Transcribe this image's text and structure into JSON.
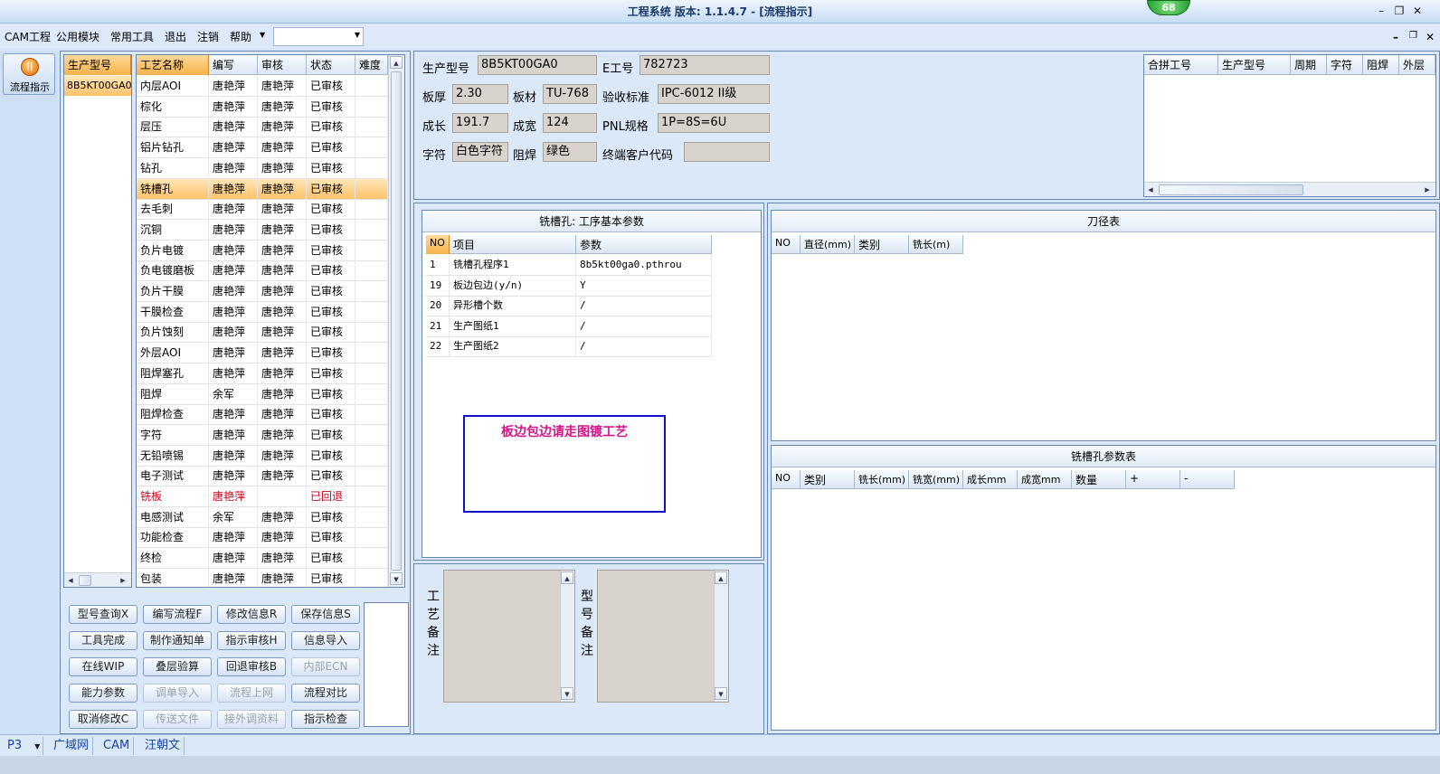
{
  "window": {
    "title": "工程系统    版本: 1.1.4.7 - [流程指示]",
    "badge": "68"
  },
  "menu": [
    "CAM工程",
    "公用模块",
    "常用工具",
    "退出",
    "注销",
    "帮助"
  ],
  "menu_combo_value": "",
  "sidebar": {
    "flow_button_label": "流程指示"
  },
  "model_list": {
    "header": "生产型号",
    "items": [
      "8B5KT00GA0"
    ]
  },
  "process_table": {
    "columns": [
      "工艺名称",
      "编写",
      "审核",
      "状态",
      "难度"
    ],
    "selected_index": 5,
    "rows": [
      [
        "内层AOI",
        "唐艳萍",
        "唐艳萍",
        "已审核",
        ""
      ],
      [
        "棕化",
        "唐艳萍",
        "唐艳萍",
        "已审核",
        ""
      ],
      [
        "层压",
        "唐艳萍",
        "唐艳萍",
        "已审核",
        ""
      ],
      [
        "铝片钻孔",
        "唐艳萍",
        "唐艳萍",
        "已审核",
        ""
      ],
      [
        "钻孔",
        "唐艳萍",
        "唐艳萍",
        "已审核",
        ""
      ],
      [
        "铣槽孔",
        "唐艳萍",
        "唐艳萍",
        "已审核",
        ""
      ],
      [
        "去毛刺",
        "唐艳萍",
        "唐艳萍",
        "已审核",
        ""
      ],
      [
        "沉铜",
        "唐艳萍",
        "唐艳萍",
        "已审核",
        ""
      ],
      [
        "负片电镀",
        "唐艳萍",
        "唐艳萍",
        "已审核",
        ""
      ],
      [
        "负电镀磨板",
        "唐艳萍",
        "唐艳萍",
        "已审核",
        ""
      ],
      [
        "负片干膜",
        "唐艳萍",
        "唐艳萍",
        "已审核",
        ""
      ],
      [
        "干膜检查",
        "唐艳萍",
        "唐艳萍",
        "已审核",
        ""
      ],
      [
        "负片蚀刻",
        "唐艳萍",
        "唐艳萍",
        "已审核",
        ""
      ],
      [
        "外层AOI",
        "唐艳萍",
        "唐艳萍",
        "已审核",
        ""
      ],
      [
        "阻焊塞孔",
        "唐艳萍",
        "唐艳萍",
        "已审核",
        ""
      ],
      [
        "阻焊",
        "余军",
        "唐艳萍",
        "已审核",
        ""
      ],
      [
        "阻焊检查",
        "唐艳萍",
        "唐艳萍",
        "已审核",
        ""
      ],
      [
        "字符",
        "唐艳萍",
        "唐艳萍",
        "已审核",
        ""
      ],
      [
        "无铅喷锡",
        "唐艳萍",
        "唐艳萍",
        "已审核",
        ""
      ],
      [
        "电子测试",
        "唐艳萍",
        "唐艳萍",
        "已审核",
        ""
      ],
      [
        "铣板",
        "唐艳萍",
        "",
        "已回退",
        ""
      ],
      [
        "电感测试",
        "余军",
        "唐艳萍",
        "已审核",
        ""
      ],
      [
        "功能检查",
        "唐艳萍",
        "唐艳萍",
        "已审核",
        ""
      ],
      [
        "终检",
        "唐艳萍",
        "唐艳萍",
        "已审核",
        ""
      ],
      [
        "包装",
        "唐艳萍",
        "唐艳萍",
        "已审核",
        ""
      ]
    ],
    "rejected_index": 20
  },
  "buttons": [
    {
      "label": "型号查询X",
      "enabled": true
    },
    {
      "label": "编写流程F",
      "enabled": true
    },
    {
      "label": "修改信息R",
      "enabled": true
    },
    {
      "label": "保存信息S",
      "enabled": true
    },
    {
      "label": "工具完成",
      "enabled": true
    },
    {
      "label": "制作通知单",
      "enabled": true
    },
    {
      "label": "指示审核H",
      "enabled": true
    },
    {
      "label": "信息导入",
      "enabled": true
    },
    {
      "label": "在线WIP",
      "enabled": true
    },
    {
      "label": "叠层验算",
      "enabled": true
    },
    {
      "label": "回退审核B",
      "enabled": true
    },
    {
      "label": "内部ECN",
      "enabled": false
    },
    {
      "label": "能力参数",
      "enabled": true
    },
    {
      "label": "调单导入",
      "enabled": false
    },
    {
      "label": "流程上网",
      "enabled": false
    },
    {
      "label": "流程对比",
      "enabled": true
    },
    {
      "label": "取消修改C",
      "enabled": true
    },
    {
      "label": "传送文件",
      "enabled": false
    },
    {
      "label": "接外调资料",
      "enabled": false
    },
    {
      "label": "指示检查",
      "enabled": true
    }
  ],
  "info": {
    "model_label": "生产型号",
    "model_value": "8B5KT00GA0",
    "e_label": "E工号",
    "e_value": "782723",
    "thickness_label": "板厚",
    "thickness_value": "2.30",
    "material_label": "板材",
    "material_value": "TU-768",
    "standard_label": "验收标准",
    "standard_value": "IPC-6012 II级",
    "length_label": "成长",
    "length_value": "191.7",
    "width_label": "成宽",
    "width_value": "124",
    "pnl_label": "PNL规格",
    "pnl_value": "1P=8S=6U",
    "char_label": "字符",
    "char_value": "白色字符",
    "mask_label": "阻焊",
    "mask_value": "绿色",
    "customer_label": "终端客户代码",
    "customer_value": ""
  },
  "merge_table": {
    "columns": [
      "合拼工号",
      "生产型号",
      "周期",
      "字符",
      "阻焊",
      "外层"
    ]
  },
  "params": {
    "title": "铣槽孔: 工序基本参数",
    "columns": [
      "NO",
      "项目",
      "参数"
    ],
    "rows": [
      [
        "1",
        "铣槽孔程序1",
        "8b5kt00ga0.pthrou"
      ],
      [
        "19",
        "板边包边(y/n)",
        "Y"
      ],
      [
        "20",
        "异形槽个数",
        "/"
      ],
      [
        "21",
        "生产图纸1",
        "/"
      ],
      [
        "22",
        "生产图纸2",
        "/"
      ]
    ],
    "note": "板边包边请走图镀工艺"
  },
  "tool_table": {
    "title": "刀径表",
    "columns": [
      "NO",
      "直径(mm)",
      "类别",
      "铣长(m)"
    ]
  },
  "slot_table": {
    "title": "铣槽孔参数表",
    "columns": [
      "NO",
      "类别",
      "铣长(mm)",
      "铣宽(mm)",
      "成长mm",
      "成宽mm",
      "数量",
      "+",
      "-"
    ]
  },
  "remarks": {
    "process_label": "工艺备注",
    "model_label": "型号备注"
  },
  "status": {
    "p": "P3",
    "items": [
      "广域网",
      "CAM",
      "汪朝文"
    ]
  }
}
